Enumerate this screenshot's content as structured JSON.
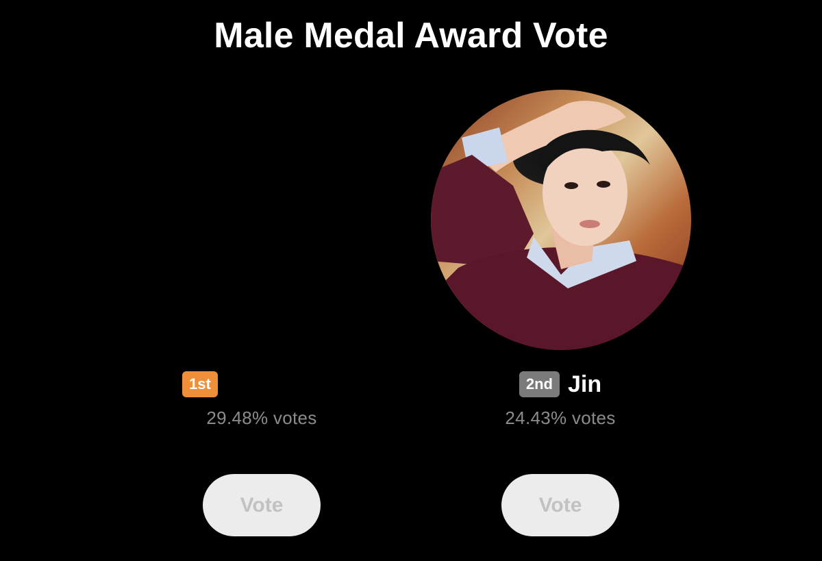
{
  "header": {
    "title": "Male Medal Award Vote"
  },
  "candidates": [
    {
      "rank_label": "1st",
      "name": "",
      "votes_text": "29.48% votes",
      "vote_button_label": "Vote",
      "badge_color": "#ef8f3a"
    },
    {
      "rank_label": "2nd",
      "name": "Jin",
      "votes_text": "24.43% votes",
      "vote_button_label": "Vote",
      "badge_color": "#7b7b7b"
    }
  ],
  "colors": {
    "background": "#000000",
    "title": "#ffffff",
    "votes_text": "#8c8c8c",
    "button_bg": "#ececec",
    "button_text": "#c2c2c2"
  }
}
